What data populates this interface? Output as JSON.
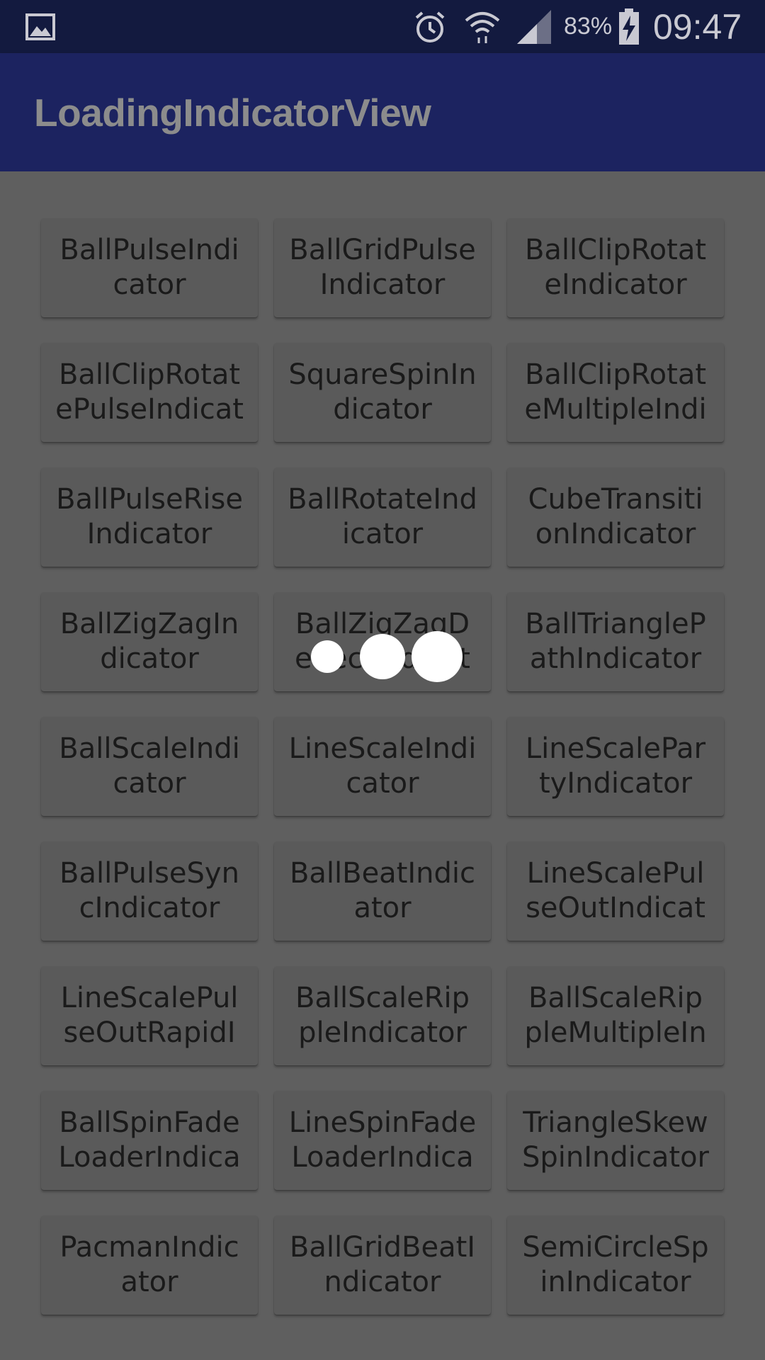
{
  "status_bar": {
    "battery_percent": "83%",
    "time": "09:47",
    "icons": [
      "gallery-notification-icon",
      "alarm-icon",
      "wifi-icon",
      "signal-icon",
      "battery-charging-icon"
    ]
  },
  "app_bar": {
    "title": "LoadingIndicatorView"
  },
  "indicators": [
    "BallPulseIndicator",
    "BallGridPulseIndicator",
    "BallClipRotateIndicator",
    "BallClipRotatePulseIndicator",
    "SquareSpinIndicator",
    "BallClipRotateMultipleIndicator",
    "BallPulseRiseIndicator",
    "BallRotateIndicator",
    "CubeTransitionIndicator",
    "BallZigZagIndicator",
    "BallZigZagDeflectIndicator",
    "BallTrianglePathIndicator",
    "BallScaleIndicator",
    "LineScaleIndicator",
    "LineScalePartyIndicator",
    "BallPulseSyncIndicator",
    "BallBeatIndicator",
    "LineScalePulseOutIndicator",
    "LineScalePulseOutRapidIndicator",
    "BallScaleRippleIndicator",
    "BallScaleRippleMultipleIndicator",
    "BallSpinFadeLoaderIndicator",
    "LineSpinFadeLoaderIndicator",
    "TriangleSkewSpinIndicator",
    "PacmanIndicator",
    "BallGridBeatIndicator",
    "SemiCircleSpinIndicator"
  ],
  "colors": {
    "status_bar": "#131a3f",
    "app_bar": "#1c2360",
    "scrim_background": "#5f5f5f",
    "button": "#5a5a5a",
    "loader_dots": "#ffffff"
  },
  "loading_overlay": {
    "type": "ball-pulse",
    "dot_count": 3
  }
}
